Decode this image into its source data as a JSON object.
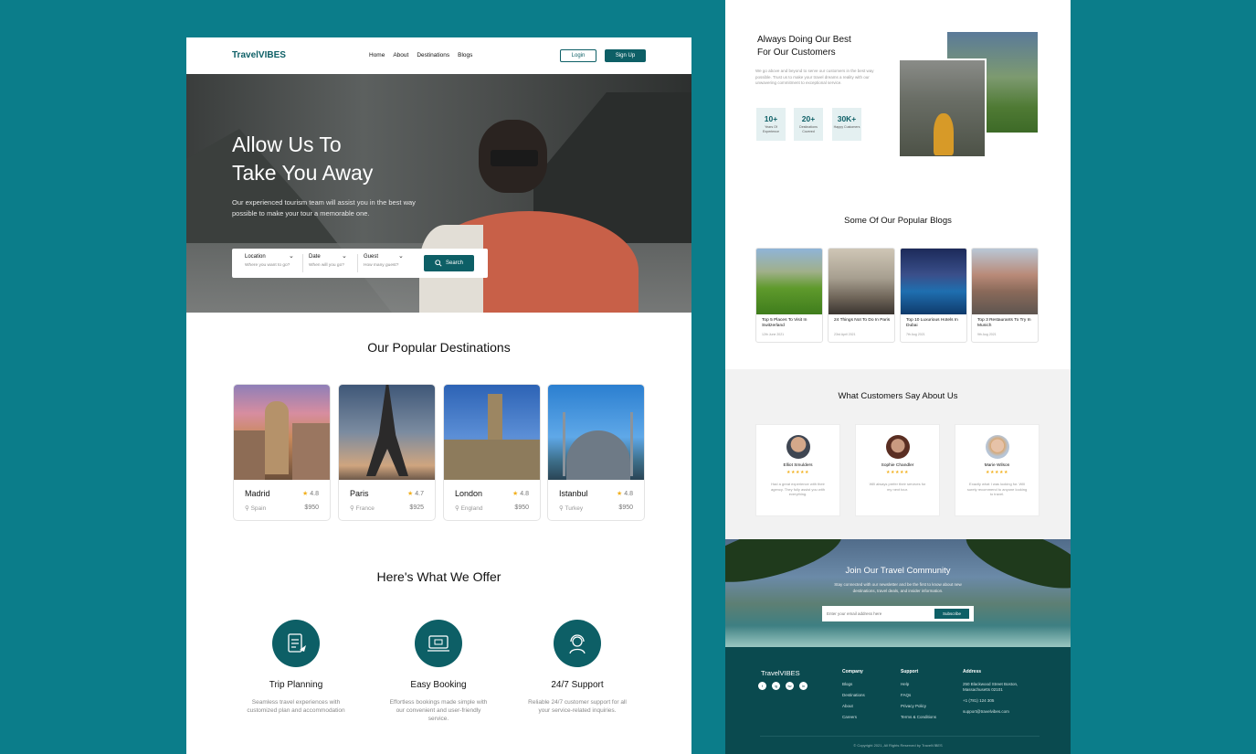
{
  "left": {
    "nav": {
      "logo": "TravelVIBES",
      "links": [
        "Home",
        "About",
        "Destinations",
        "Blogs"
      ],
      "login": "Login",
      "signup": "Sign Up"
    },
    "hero": {
      "title_line1": "Allow Us To",
      "title_line2": "Take You Away",
      "subtitle": "Our experienced tourism team will assist you in the best way possible to make your tour a memorable one.",
      "search": {
        "location_label": "Location",
        "location_placeholder": "Where you want to go?",
        "date_label": "Date",
        "date_placeholder": "When will you go?",
        "guest_label": "Guest",
        "guest_placeholder": "How many guest?",
        "button": "Search"
      }
    },
    "destinations": {
      "title": "Our Popular Destinations",
      "items": [
        {
          "name": "Madrid",
          "rating": "4.8",
          "country": "Spain",
          "price": "$950"
        },
        {
          "name": "Paris",
          "rating": "4.7",
          "country": "France",
          "price": "$925"
        },
        {
          "name": "London",
          "rating": "4.8",
          "country": "England",
          "price": "$950"
        },
        {
          "name": "Istanbul",
          "rating": "4.8",
          "country": "Turkey",
          "price": "$950"
        }
      ]
    },
    "offer": {
      "title": "Here's What We Offer",
      "items": [
        {
          "title": "Trip Planning",
          "desc": "Seamless travel experiences with customized plan and accommodation"
        },
        {
          "title": "Easy Booking",
          "desc": "Effortless bookings made simple with our convenient and user-friendly service."
        },
        {
          "title": "24/7 Support",
          "desc": "Reliable 24/7 customer support for all your service-related inquiries."
        }
      ]
    }
  },
  "right": {
    "about": {
      "title_line1": "Always Doing Our Best",
      "title_line2": "For Our Customers",
      "text": "We go above and beyond to serve our customers in the best way possible. Trust us to make your travel dreams a reality with our unwavering commitment to exceptional service.",
      "stats": [
        {
          "num": "10+",
          "label": "Years Of Experience"
        },
        {
          "num": "20+",
          "label": "Destinations Covered"
        },
        {
          "num": "30K+",
          "label": "Happy Customers"
        }
      ]
    },
    "blogs": {
      "title": "Some Of Our Popular Blogs",
      "items": [
        {
          "title": "Top 5 Places To Visit In Switzerland",
          "date": "12th June 2021"
        },
        {
          "title": "24 Things Not To Do In Paris",
          "date": "23rd April 2021"
        },
        {
          "title": "Top 10 Luxurious Hotels In Dubai",
          "date": "7th Aug 2021"
        },
        {
          "title": "Top 3 Restaurants To Try In Munich",
          "date": "9th Aug 2021"
        }
      ]
    },
    "testimonials": {
      "title": "What Customers Say About Us",
      "items": [
        {
          "name": "Elliot Smulders",
          "stars": "★★★★★",
          "text": "Had a great experience with their agency. They fully assist you with everything."
        },
        {
          "name": "Sophie Chandler",
          "stars": "★★★★★",
          "text": "Will always prefer their services for my next tour."
        },
        {
          "name": "Marie Wilson",
          "stars": "★★★★★",
          "text": "Exactly what I was looking for. Will surely recommend to anyone looking to travel."
        }
      ]
    },
    "newsletter": {
      "title": "Join Our Travel Community",
      "text": "Stay connected with our newsletter and be the first to know about new destinations, travel deals, and insider information.",
      "placeholder": "Enter your email address here",
      "button": "Subscribe"
    },
    "footer": {
      "logo": "TravelVIBES",
      "social": [
        "f",
        "ig",
        "tw",
        "in"
      ],
      "company_title": "Company",
      "company": [
        "Blogs",
        "Destinations",
        "About",
        "Careers"
      ],
      "support_title": "Support",
      "support": [
        "Help",
        "FAQs",
        "Privacy Policy",
        "Terms & Conditions"
      ],
      "address_title": "Address",
      "address": "250 Blackwood Street Boston, Massachusetts 02101",
      "phone": "+1 (781) 124 305",
      "email": "support@travelvibes.com",
      "copyright": "© Copyright 2021, All Rights Reserved by TravelVIBES"
    }
  },
  "colors": {
    "brand": "#0d5f66",
    "background": "#0b7d8a",
    "star": "#f2b01e"
  }
}
